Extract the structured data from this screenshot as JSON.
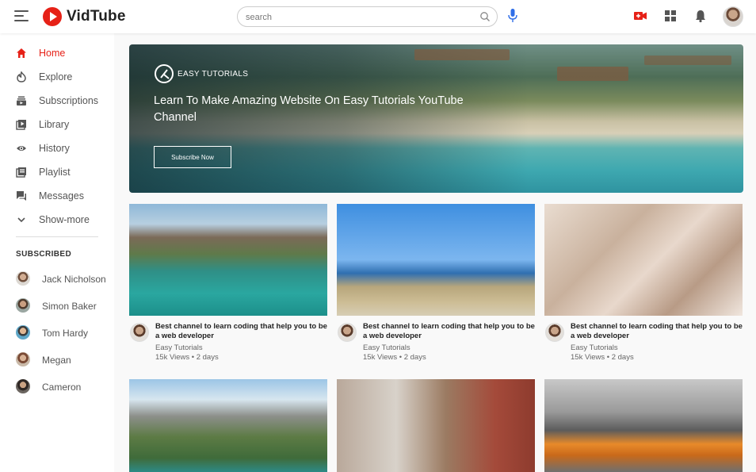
{
  "header": {
    "brand": "VidTube",
    "search_placeholder": "search"
  },
  "sidebar": {
    "items": [
      {
        "label": "Home",
        "icon": "home-icon",
        "active": true
      },
      {
        "label": "Explore",
        "icon": "explore-icon"
      },
      {
        "label": "Subscriptions",
        "icon": "subscriptions-icon"
      },
      {
        "label": "Library",
        "icon": "library-icon"
      },
      {
        "label": "History",
        "icon": "history-icon"
      },
      {
        "label": "Playlist",
        "icon": "playlist-icon"
      },
      {
        "label": "Messages",
        "icon": "messages-icon"
      },
      {
        "label": "Show-more",
        "icon": "chevron-down-icon"
      }
    ],
    "subscribed_heading": "SUBSCRIBED",
    "subscribed": [
      {
        "name": "Jack Nicholson"
      },
      {
        "name": "Simon Baker"
      },
      {
        "name": "Tom Hardy"
      },
      {
        "name": "Megan"
      },
      {
        "name": "Cameron"
      }
    ]
  },
  "banner": {
    "brand": "EASY TUTORIALS",
    "title": "Learn To Make Amazing Website On Easy Tutorials YouTube Channel",
    "button": "Subscribe Now"
  },
  "videos": [
    {
      "title": "Best channel to learn coding that help you to be a web developer",
      "channel": "Easy Tutorials",
      "meta": "15k Views • 2 days"
    },
    {
      "title": "Best channel to learn coding that help you to be a web developer",
      "channel": "Easy Tutorials",
      "meta": "15k Views • 2 days"
    },
    {
      "title": "Best channel to learn coding that help you to be a web developer",
      "channel": "Easy Tutorials",
      "meta": "15k Views • 2 days"
    }
  ],
  "colors": {
    "accent": "#e62117",
    "background": "#f9f9f9"
  }
}
